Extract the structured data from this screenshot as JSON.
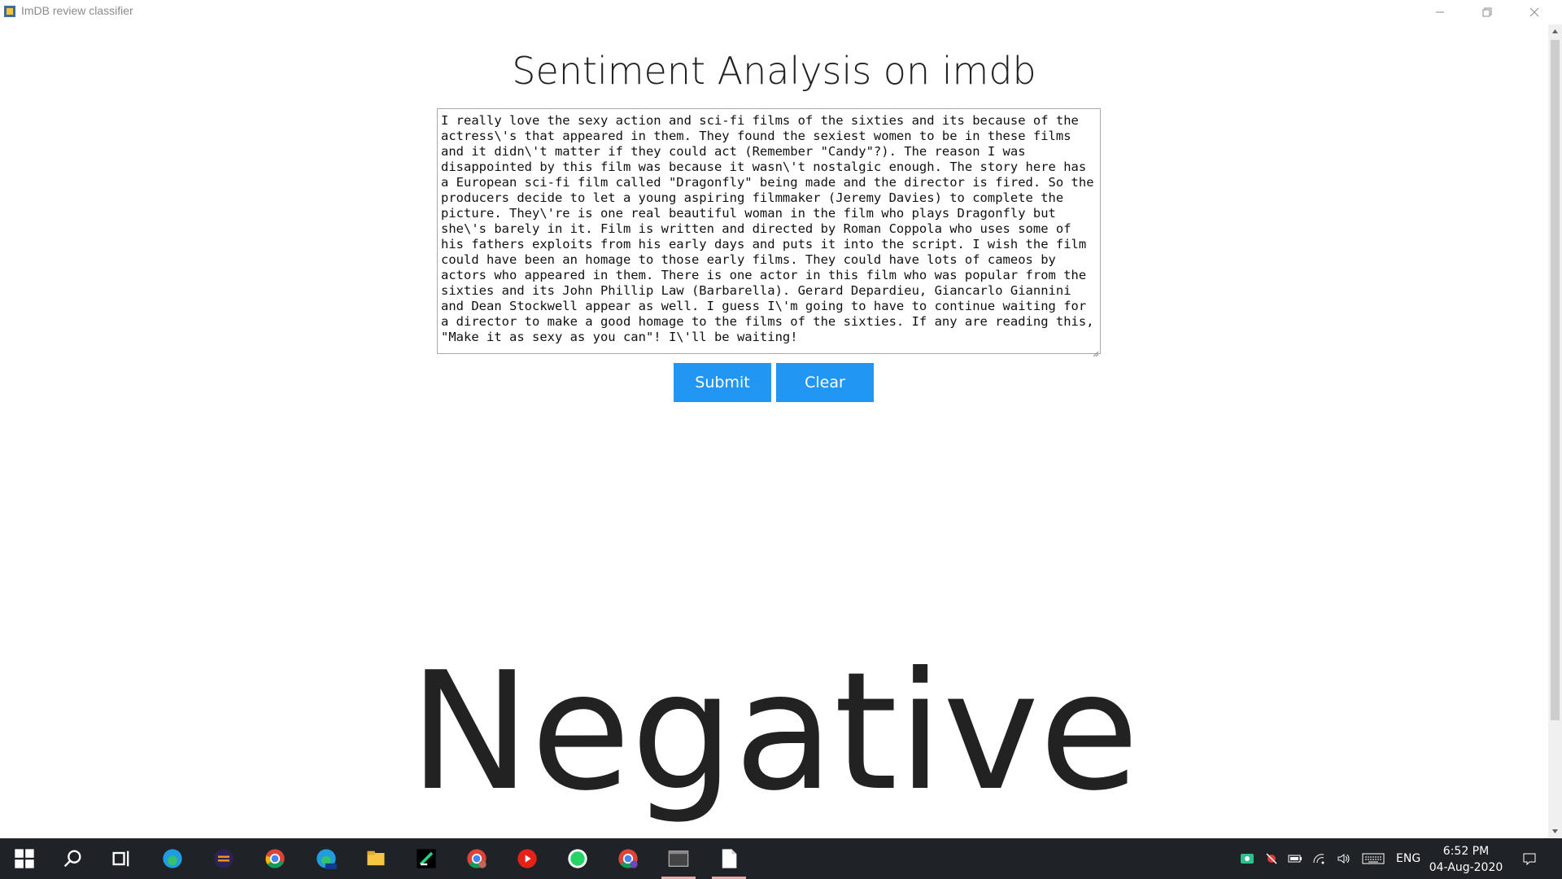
{
  "window": {
    "title": "ImDB review classifier"
  },
  "main": {
    "heading": "Sentiment Analysis on imdb",
    "review_text": "I really love the sexy action and sci-fi films of the sixties and its because of the actress\\'s that appeared in them. They found the sexiest women to be in these films and it didn\\'t matter if they could act (Remember \"Candy\"?). The reason I was disappointed by this film was because it wasn\\'t nostalgic enough. The story here has a European sci-fi film called \"Dragonfly\" being made and the director is fired. So the producers decide to let a young aspiring filmmaker (Jeremy Davies) to complete the picture. They\\'re is one real beautiful woman in the film who plays Dragonfly but she\\'s barely in it. Film is written and directed by Roman Coppola who uses some of his fathers exploits from his early days and puts it into the script. I wish the film could have been an homage to those early films. They could have lots of cameos by actors who appeared in them. There is one actor in this film who was popular from the sixties and its John Phillip Law (Barbarella). Gerard Depardieu, Giancarlo Giannini and Dean Stockwell appear as well. I guess I\\'m going to have to continue waiting for a director to make a good homage to the films of the sixties. If any are reading this, \"Make it as sexy as you can\"! I\\'ll be waiting!",
    "submit_label": "Submit",
    "clear_label": "Clear",
    "result": "Negative",
    "button_color": "#2196f3"
  },
  "taskbar": {
    "items": [
      "windows-start",
      "search",
      "task-view",
      "edge",
      "eclipse",
      "chrome",
      "edge-beta",
      "file-explorer",
      "pycharm",
      "chrome-profile",
      "youtube",
      "whatsapp",
      "chrome-profile-2",
      "terminal",
      "notepad"
    ],
    "language": "ENG",
    "time": "6:52 PM",
    "date": "04-Aug-2020"
  }
}
